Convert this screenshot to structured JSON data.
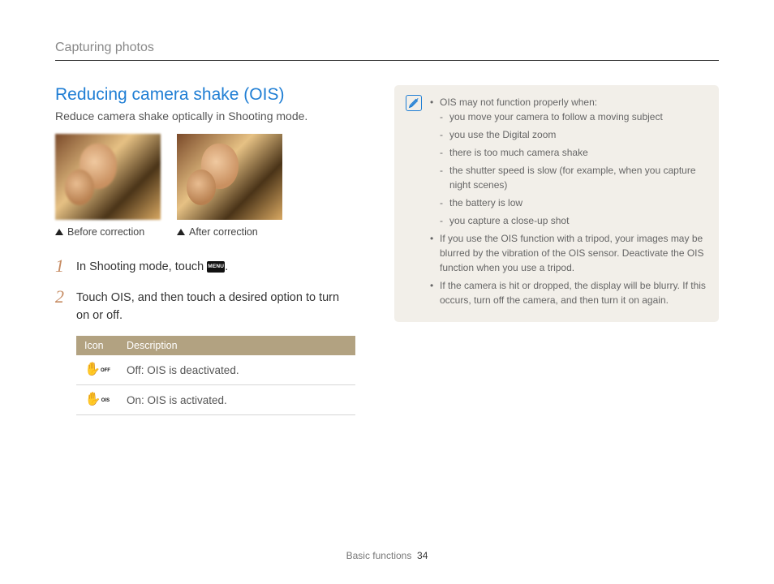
{
  "header": {
    "section": "Capturing photos"
  },
  "main": {
    "title": "Reducing camera shake (OIS)",
    "subtitle": "Reduce camera shake optically in Shooting mode.",
    "captions": {
      "before": "Before correction",
      "after": "After correction"
    },
    "steps": [
      {
        "num": "1",
        "pre": "In Shooting mode, touch ",
        "post": "."
      },
      {
        "num": "2",
        "pre": "Touch ",
        "bold": "OIS",
        "post": ", and then touch a desired option to turn on or off."
      }
    ],
    "menu_label": "MENU",
    "table": {
      "headers": {
        "icon": "Icon",
        "desc": "Description"
      },
      "rows": [
        {
          "icon_sub": "OFF",
          "bold": "Off",
          "rest": ": OIS is deactivated."
        },
        {
          "icon_sub": "OIS",
          "bold": "On",
          "rest": ": OIS is activated."
        }
      ]
    }
  },
  "notes": {
    "intro": "OIS may not function properly when:",
    "sub": [
      "you move your camera to follow a moving subject",
      "you use the Digital zoom",
      "there is too much camera shake",
      "the shutter speed is slow (for example, when you capture night scenes)",
      "the battery is low",
      "you capture a close-up shot"
    ],
    "b2": "If you use the OIS function with a tripod, your images may be blurred by the vibration of the OIS sensor. Deactivate the OIS function when you use a tripod.",
    "b3": "If the camera is hit or dropped, the display will be blurry. If this occurs, turn off the camera, and then turn it on again."
  },
  "footer": {
    "section": "Basic functions",
    "page": "34"
  }
}
